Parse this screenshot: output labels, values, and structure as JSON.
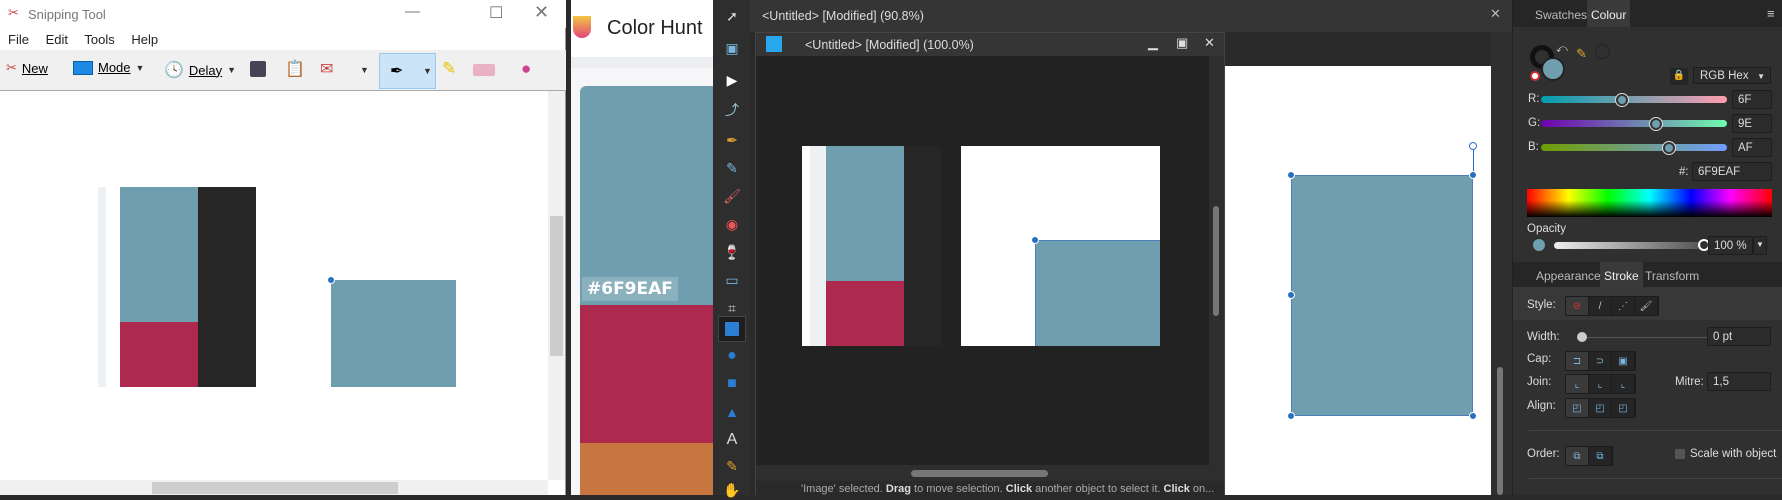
{
  "snipping_tool": {
    "title": "Snipping Tool",
    "menu": [
      "File",
      "Edit",
      "Tools",
      "Help"
    ],
    "toolbar": {
      "new": "New",
      "mode": "Mode",
      "delay": "Delay"
    }
  },
  "color_hunt": {
    "brand": "Color Hunt",
    "hex_label": "#6F9EAF",
    "palette": [
      "#6F9EAF",
      "#AD2A4E",
      "#C8763F"
    ]
  },
  "affinity": {
    "outer_title": "<Untitled> [Modified] (90.8%)",
    "inner_title": "<Untitled> [Modified] (100.0%)",
    "status": {
      "p1": "'Image' selected. ",
      "b1": "Drag",
      "p2": " to move selection. ",
      "b2": "Click",
      "p3": " another object to select it. ",
      "b3": "Click",
      "p4": " on..."
    },
    "colour_panel": {
      "tabs": [
        "Swatches",
        "Colour"
      ],
      "model": "RGB Hex",
      "r_label": "R:",
      "g_label": "G:",
      "b_label": "B:",
      "r": "6F",
      "g": "9E",
      "b": "AF",
      "r_fraction": 0.435,
      "g_fraction": 0.62,
      "b_fraction": 0.686,
      "hex_label": "#:",
      "hex": "6F9EAF",
      "opacity_label": "Opacity",
      "opacity": "100 %"
    },
    "stroke_panel": {
      "tabs": [
        "Appearance",
        "Stroke",
        "Transform"
      ],
      "style_label": "Style:",
      "width_label": "Width:",
      "width": "0 pt",
      "cap_label": "Cap:",
      "join_label": "Join:",
      "mitre_label": "Mitre:",
      "mitre": "1,5",
      "align_label": "Align:",
      "order_label": "Order:",
      "scale_with_object": "Scale with object"
    },
    "fill_color": "#6F9EAF"
  }
}
